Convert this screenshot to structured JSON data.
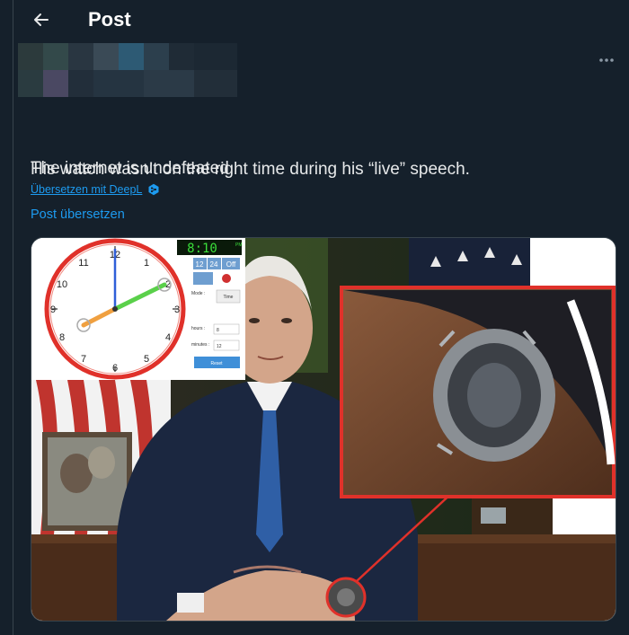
{
  "header": {
    "title": "Post"
  },
  "icons": {
    "back": "arrow-left-icon",
    "more": "more-horizontal-icon",
    "deepl": "deepl-logo-icon"
  },
  "tweet": {
    "line1": "His watch wasn’t on the right time during his “live” speech.",
    "line2": "The internet is undefeated",
    "translate_deepl": "Übersetzen mit DeepL",
    "translate_post": "Post übersetzen"
  },
  "media": {
    "clock_app": {
      "digital_time": "8:10",
      "digital_suffix": "PM",
      "mode_12": "12",
      "mode_24": "24",
      "mode_off": "Off",
      "mode_label": "Mode :",
      "mode_value": "Time",
      "hours_label": "hours :",
      "hours_value": "8",
      "minutes_label": "minutes :",
      "minutes_value": "12",
      "reset_label": "Reset"
    }
  },
  "colors": {
    "background": "#15202b",
    "link": "#1d9bf0",
    "highlight": "#e0312a"
  }
}
